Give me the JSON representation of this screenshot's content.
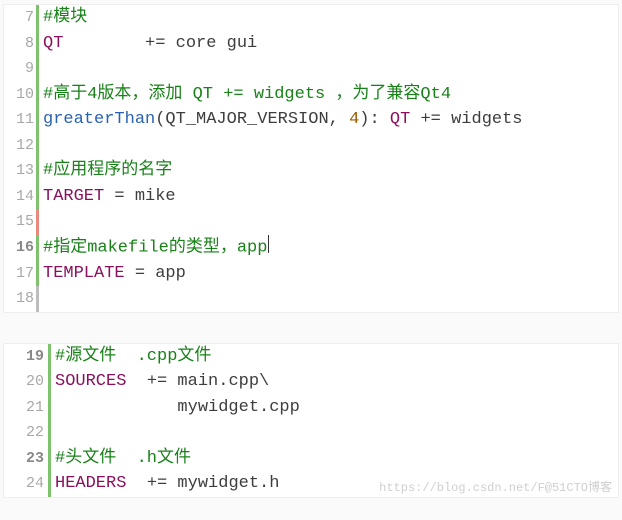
{
  "block1": {
    "l7": {
      "num": "7",
      "text": "#模块"
    },
    "l8": {
      "num": "8",
      "kw": "QT",
      "mid": "        += core gui"
    },
    "l9": {
      "num": "9"
    },
    "l10": {
      "num": "10",
      "text": "#高于4版本，添加 QT += widgets ，为了兼容Qt4"
    },
    "l11": {
      "num": "11",
      "fn": "greaterThan",
      "open": "(",
      "arg": "QT_MAJOR_VERSION",
      "sep": ", ",
      "numv": "4",
      "close": "): ",
      "kw": "QT",
      "tail": " += widgets"
    },
    "l12": {
      "num": "12"
    },
    "l13": {
      "num": "13",
      "text": "#应用程序的名字"
    },
    "l14": {
      "num": "14",
      "kw": "TARGET",
      "mid": " = mike"
    },
    "l15": {
      "num": "15"
    },
    "l16": {
      "num": "16",
      "text": "#指定makefile的类型，app"
    },
    "l17": {
      "num": "17",
      "kw": "TEMPLATE",
      "mid": " = app"
    },
    "l18": {
      "num": "18"
    }
  },
  "block2": {
    "l19": {
      "num": "19",
      "text": "#源文件  .cpp文件"
    },
    "l20": {
      "num": "20",
      "kw": "SOURCES",
      "mid": "  += main.cpp\\"
    },
    "l21": {
      "num": "21",
      "mid": "            mywidget.cpp"
    },
    "l22": {
      "num": "22"
    },
    "l23": {
      "num": "23",
      "text": "#头文件  .h文件"
    },
    "l24": {
      "num": "24",
      "kw": "HEADERS",
      "mid": "  += mywidget.h"
    }
  },
  "watermark": "https://blog.csdn.net/F@51CTO博客"
}
